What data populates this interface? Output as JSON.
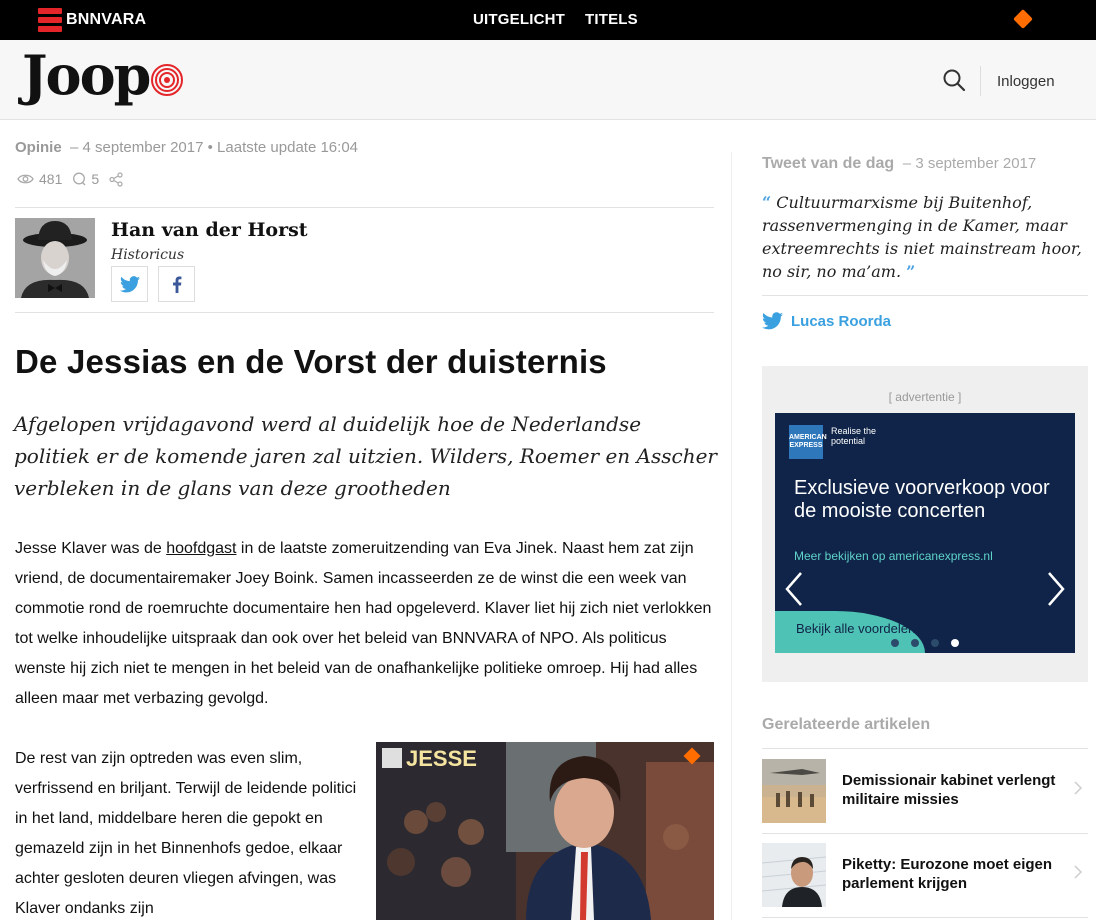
{
  "network": {
    "brand": "BNNVARA",
    "nav": [
      "UITGELICHT",
      "TITELS"
    ],
    "npo_icon": "npo-diamond-icon",
    "brand_color": "#e4262a"
  },
  "header": {
    "logo_text": "Joop",
    "login_label": "Inloggen",
    "accent_color": "#e4262a"
  },
  "article": {
    "category": "Opinie",
    "date": "4 september 2017",
    "updated": "Laatste update 16:04",
    "views": "481",
    "comments": "5",
    "author": {
      "name": "Han van der Horst",
      "role": "Historicus"
    },
    "title": "De Jessias en de Vorst der duisternis",
    "intro": "Afgelopen vrijdagavond werd al duidelijk hoe de Nederlandse politiek er de komende jaren zal uitzien. Wilders, Roemer en Asscher verbleken in de glans van deze grootheden",
    "p1_before": "Jesse Klaver was de ",
    "p1_link": "hoofdgast",
    "p1_after": " in de laatste zomeruitzending van Eva Jinek. Naast hem zat zijn vriend, de documentairemaker Joey Boink. Samen incasseerden ze de winst die een week van commotie rond de roemruchte documentaire hen had opgeleverd. Klaver liet hij zich niet verlokken tot welke inhoudelijke uitspraak dan ook over het beleid van BNNVARA of NPO. Als politicus wenste hij zich niet te mengen in het beleid van de onafhankelijke politieke omroep. Hij had alles alleen maar met verbazing gevolgd.",
    "p2": "De rest van zijn optreden was even slim, verfrissend en briljant. Terwijl de leidende politici in het land, middelbare heren die gepokt en gemazeld zijn in het Binnenhofs gedoe, elkaar achter gesloten deuren vliegen afvingen, was Klaver ondanks zijn",
    "image_caption_text": "JESSE"
  },
  "sidebar": {
    "tweet": {
      "label": "Tweet van de dag",
      "date": "3 september 2017",
      "text": "Cultuurmarxisme bij Buitenhof, rassenvermenging in de Kamer, maar extreemrechts is niet mainstream hoor, no sir, no ma’am.",
      "author": "Lucas Roorda",
      "twitter_color": "#3aa0df"
    },
    "ad": {
      "label": "[ advertentie ]",
      "brand_logo": "AMERICAN EXPRESS",
      "tagline": "Realise the potential",
      "headline": "Exclusieve voorverkoop voor de mooiste concerten",
      "sub": "Meer bekijken op americanexpress.nl",
      "cta": "Bekijk alle voordelen ›",
      "active_slide": 3
    },
    "related": {
      "heading": "Gerelateerde artikelen",
      "items": [
        {
          "title": "Demissionair kabinet verlengt militaire missies"
        },
        {
          "title": "Piketty: Eurozone moet eigen parlement krijgen"
        }
      ]
    }
  }
}
